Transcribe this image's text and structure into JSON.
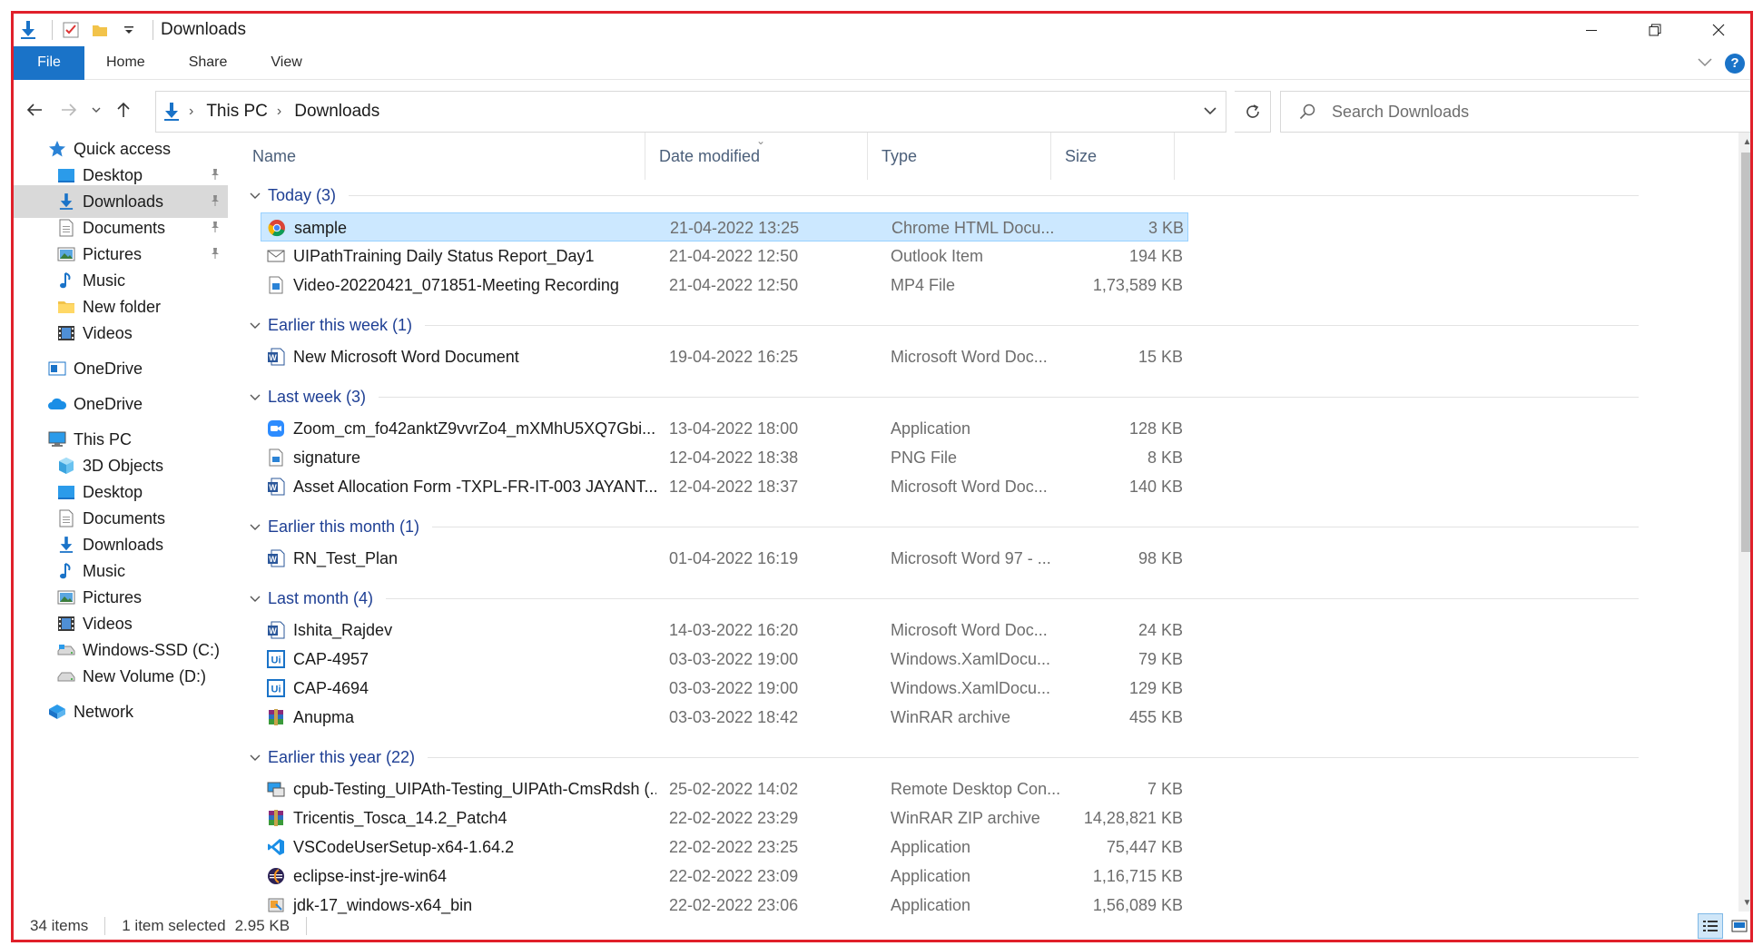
{
  "window": {
    "title": "Downloads",
    "controls": {
      "minimize": "minimize",
      "maximize": "restore",
      "close": "close"
    }
  },
  "ribbon": {
    "file_tab": "File",
    "tabs": [
      "Home",
      "Share",
      "View"
    ]
  },
  "address": {
    "crumbs": [
      "This PC",
      "Downloads"
    ]
  },
  "search": {
    "placeholder": "Search Downloads"
  },
  "nav": {
    "items": [
      {
        "label": "Quick access",
        "icon": "star-icon",
        "pinned": false
      },
      {
        "label": "Desktop",
        "icon": "desktop-folder-icon",
        "pinned": true
      },
      {
        "label": "Downloads",
        "icon": "download-arrow-icon",
        "pinned": true,
        "selected": true
      },
      {
        "label": "Documents",
        "icon": "documents-icon",
        "pinned": true
      },
      {
        "label": "Pictures",
        "icon": "pictures-icon",
        "pinned": true
      },
      {
        "label": "Music",
        "icon": "music-note-icon",
        "pinned": false
      },
      {
        "label": "New folder",
        "icon": "folder-icon",
        "pinned": false
      },
      {
        "label": "Videos",
        "icon": "film-icon",
        "pinned": false
      },
      {
        "label": "OneDrive",
        "icon": "onedrive-business-icon",
        "pinned": false
      },
      {
        "label": "OneDrive",
        "icon": "cloud-icon",
        "pinned": false
      },
      {
        "label": "This PC",
        "icon": "computer-icon",
        "pinned": false
      },
      {
        "label": "3D Objects",
        "icon": "cube-icon",
        "pinned": false
      },
      {
        "label": "Desktop",
        "icon": "desktop-folder-icon",
        "pinned": false
      },
      {
        "label": "Documents",
        "icon": "documents-icon",
        "pinned": false
      },
      {
        "label": "Downloads",
        "icon": "download-arrow-icon",
        "pinned": false
      },
      {
        "label": "Music",
        "icon": "music-note-icon",
        "pinned": false
      },
      {
        "label": "Pictures",
        "icon": "pictures-icon",
        "pinned": false
      },
      {
        "label": "Videos",
        "icon": "film-icon",
        "pinned": false
      },
      {
        "label": "Windows-SSD (C:)",
        "icon": "drive-c-icon",
        "pinned": false
      },
      {
        "label": "New Volume (D:)",
        "icon": "drive-icon",
        "pinned": false
      },
      {
        "label": "Network",
        "icon": "network-icon",
        "pinned": false
      }
    ]
  },
  "columns": {
    "name": "Name",
    "date": "Date modified",
    "type": "Type",
    "size": "Size"
  },
  "groups": [
    {
      "label": "Today (3)",
      "files": [
        {
          "name": "sample",
          "date": "21-04-2022 13:25",
          "type": "Chrome HTML Docu...",
          "size": "3 KB",
          "icon": "chrome-icon",
          "selected": true
        },
        {
          "name": "UIPathTraining Daily Status Report_Day1",
          "date": "21-04-2022 12:50",
          "type": "Outlook Item",
          "size": "194 KB",
          "icon": "envelope-icon"
        },
        {
          "name": "Video-20220421_071851-Meeting Recording",
          "date": "21-04-2022 12:50",
          "type": "MP4 File",
          "size": "1,73,589 KB",
          "icon": "video-file-icon"
        }
      ]
    },
    {
      "label": "Earlier this week (1)",
      "files": [
        {
          "name": "New Microsoft Word Document",
          "date": "19-04-2022 16:25",
          "type": "Microsoft Word Doc...",
          "size": "15 KB",
          "icon": "word-icon"
        }
      ]
    },
    {
      "label": "Last week (3)",
      "files": [
        {
          "name": "Zoom_cm_fo42anktZ9vvrZo4_mXMhU5XQ7Gbi...",
          "date": "13-04-2022 18:00",
          "type": "Application",
          "size": "128 KB",
          "icon": "zoom-icon"
        },
        {
          "name": "signature",
          "date": "12-04-2022 18:38",
          "type": "PNG File",
          "size": "8 KB",
          "icon": "image-file-icon"
        },
        {
          "name": "Asset Allocation Form -TXPL-FR-IT-003 JAYANT...",
          "date": "12-04-2022 18:37",
          "type": "Microsoft Word Doc...",
          "size": "140 KB",
          "icon": "word-icon"
        }
      ]
    },
    {
      "label": "Earlier this month (1)",
      "files": [
        {
          "name": "RN_Test_Plan",
          "date": "01-04-2022 16:19",
          "type": "Microsoft Word 97 - ...",
          "size": "98 KB",
          "icon": "word-icon"
        }
      ]
    },
    {
      "label": "Last month (4)",
      "files": [
        {
          "name": "Ishita_Rajdev",
          "date": "14-03-2022 16:20",
          "type": "Microsoft Word Doc...",
          "size": "24 KB",
          "icon": "word-icon"
        },
        {
          "name": "CAP-4957",
          "date": "03-03-2022 19:00",
          "type": "Windows.XamlDocu...",
          "size": "79 KB",
          "icon": "uipath-icon"
        },
        {
          "name": "CAP-4694",
          "date": "03-03-2022 19:00",
          "type": "Windows.XamlDocu...",
          "size": "129 KB",
          "icon": "uipath-icon"
        },
        {
          "name": "Anupma",
          "date": "03-03-2022 18:42",
          "type": "WinRAR archive",
          "size": "455 KB",
          "icon": "winrar-icon"
        }
      ]
    },
    {
      "label": "Earlier this year (22)",
      "files": [
        {
          "name": "cpub-Testing_UIPAth-Testing_UIPAth-CmsRdsh (...",
          "date": "25-02-2022 14:02",
          "type": "Remote Desktop Con...",
          "size": "7 KB",
          "icon": "remote-desktop-icon"
        },
        {
          "name": "Tricentis_Tosca_14.2_Patch4",
          "date": "22-02-2022 23:29",
          "type": "WinRAR ZIP archive",
          "size": "14,28,821 KB",
          "icon": "winrar-icon"
        },
        {
          "name": "VSCodeUserSetup-x64-1.64.2",
          "date": "22-02-2022 23:25",
          "type": "Application",
          "size": "75,447 KB",
          "icon": "vscode-icon"
        },
        {
          "name": "eclipse-inst-jre-win64",
          "date": "22-02-2022 23:09",
          "type": "Application",
          "size": "1,16,715 KB",
          "icon": "eclipse-icon"
        },
        {
          "name": "jdk-17_windows-x64_bin",
          "date": "22-02-2022 23:06",
          "type": "Application",
          "size": "1,56,089 KB",
          "icon": "installer-icon"
        }
      ]
    }
  ],
  "status": {
    "items": "34 items",
    "selected": "1 item selected",
    "selected_size": "2.95 KB"
  },
  "colors": {
    "accent": "#1a73c8",
    "group_header": "#1e3f94",
    "selection": "#cce8ff",
    "frame": "#e0202a"
  }
}
